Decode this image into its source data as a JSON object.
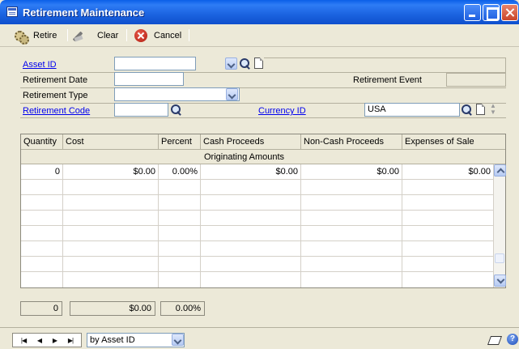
{
  "window": {
    "title": "Retirement Maintenance"
  },
  "toolbar": {
    "retire": "Retire",
    "clear": "Clear",
    "cancel": "Cancel"
  },
  "form": {
    "asset_id_label": "Asset ID",
    "asset_id_value": "",
    "retirement_date_label": "Retirement Date",
    "retirement_date_value": "",
    "retirement_event_label": "Retirement Event",
    "retirement_event_value": "",
    "retirement_type_label": "Retirement Type",
    "retirement_type_value": "",
    "retirement_code_label": "Retirement Code",
    "retirement_code_value": "",
    "currency_id_label": "Currency ID",
    "currency_id_value": "USA"
  },
  "grid": {
    "columns": [
      "Quantity",
      "Cost",
      "Percent",
      "Cash Proceeds",
      "Non-Cash Proceeds",
      "Expenses of Sale"
    ],
    "subheader": "Originating Amounts",
    "rows": [
      {
        "quantity": "0",
        "cost": "$0.00",
        "percent": "0.00%",
        "cash": "$0.00",
        "noncash": "$0.00",
        "expenses": "$0.00"
      }
    ]
  },
  "totals": {
    "quantity": "0",
    "cost": "$0.00",
    "percent": "0.00%"
  },
  "status": {
    "sort_by": "by Asset ID"
  }
}
